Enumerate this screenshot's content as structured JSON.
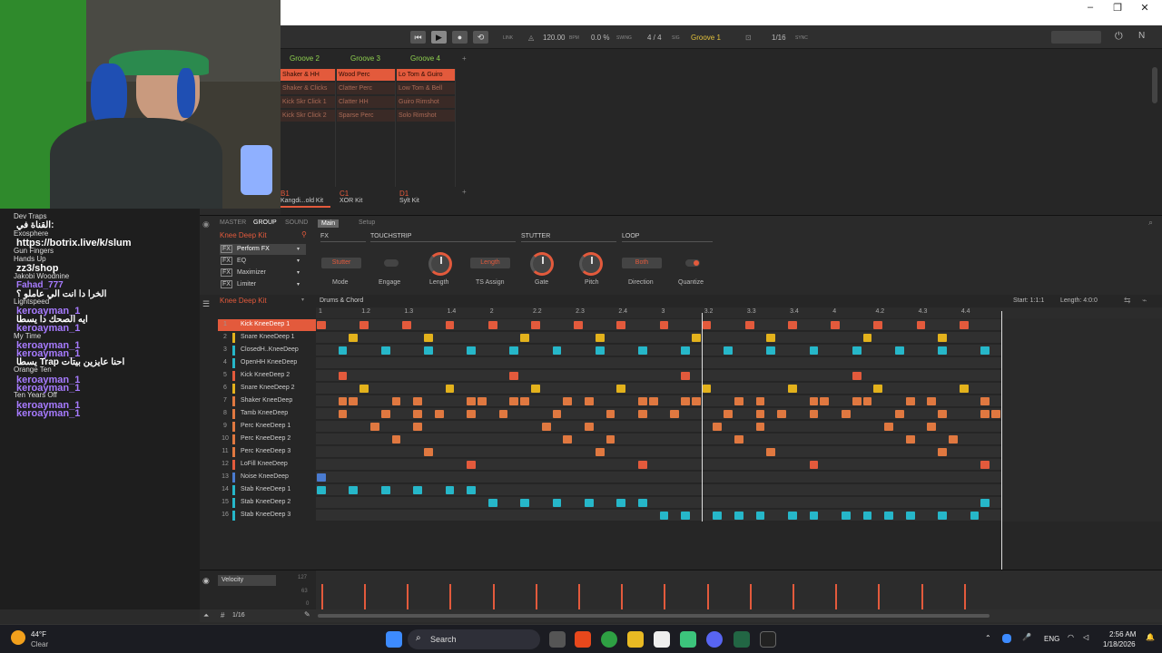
{
  "window": {
    "min": "–",
    "max": "❐",
    "close": "✕"
  },
  "transport": {
    "tempo": "120.00",
    "tempo_unit": "BPM",
    "swing": "0.0 %",
    "swing_label": "SWING",
    "sig": "4 / 4",
    "sig_label": "SIG",
    "groove": "Groove 1",
    "quant": "1/16",
    "sync": "SYNC",
    "link": "LINK"
  },
  "scenes": {
    "tabs": [
      "Groove 2",
      "Groove 3",
      "Groove 4"
    ],
    "add": "+",
    "col1": [
      "Shaker & HH",
      "Shaker & Clicks",
      "Kick Skr Click 1",
      "Kick Skr Click 2"
    ],
    "col2": [
      "Wood Perc",
      "Clatter Perc",
      "Clatter HH",
      "Sparse Perc"
    ],
    "col3": [
      "Lo Tom & Guiro",
      "Low Tom & Bell",
      "Guiro Rimshot",
      "Solo Rimshot"
    ],
    "banks": [
      {
        "id": "B1",
        "name": "Kangdi...old Kit"
      },
      {
        "id": "C1",
        "name": "XOR Kit"
      },
      {
        "id": "D1",
        "name": "Sylt Kit"
      }
    ],
    "bank_add": "+"
  },
  "chat": {
    "lines": [
      {
        "t": "Dev Traps",
        "c": "#ddd",
        "s": 8
      },
      {
        "t": "القناة في:",
        "c": "#fff",
        "s": 10
      },
      {
        "t": "Exosphere",
        "c": "#ddd",
        "s": 8
      },
      {
        "t": "https://botrix.live/k/slum",
        "c": "#fff",
        "s": 11
      },
      {
        "t": "Gun Fingers",
        "c": "#ddd",
        "s": 8
      },
      {
        "t": "Hands Up",
        "c": "#ddd",
        "s": 8
      },
      {
        "t": "zz3/shop",
        "c": "#fff",
        "s": 11
      },
      {
        "t": "Jakobi Woodnine",
        "c": "#ddd",
        "s": 8
      },
      {
        "t": "Fahad_777",
        "c": "#a77bff",
        "s": 10
      },
      {
        "t": "الخرا دا انت الي عاملو ؟",
        "c": "#fff",
        "s": 10
      },
      {
        "t": "Lightspeed",
        "c": "#ddd",
        "s": 8
      },
      {
        "t": "keroayman_1",
        "c": "#a77bff",
        "s": 11
      },
      {
        "t": "ايه الصحك دا يسطا",
        "c": "#fff",
        "s": 10
      },
      {
        "t": "keroayman_1",
        "c": "#a77bff",
        "s": 11
      },
      {
        "t": "My Time",
        "c": "#ddd",
        "s": 8
      },
      {
        "t": "keroayman_1",
        "c": "#a77bff",
        "s": 11
      },
      {
        "t": "keroayman_1",
        "c": "#a77bff",
        "s": 11
      },
      {
        "t": "يسطا Trap احنا عايزين بيتات",
        "c": "#fff",
        "s": 10
      },
      {
        "t": "Orange Ten",
        "c": "#ddd",
        "s": 8
      },
      {
        "t": "keroayman_1",
        "c": "#a77bff",
        "s": 11
      },
      {
        "t": "keroayman_1",
        "c": "#a77bff",
        "s": 11
      },
      {
        "t": "Ten Years Off",
        "c": "#ddd",
        "s": 8
      },
      {
        "t": "keroayman_1",
        "c": "#a77bff",
        "s": 11
      },
      {
        "t": "keroayman_1",
        "c": "#a77bff",
        "s": 11
      }
    ]
  },
  "fx": {
    "tabs": [
      "MASTER",
      "GROUP",
      "SOUND"
    ],
    "subtabs": [
      "Main",
      "Setup"
    ],
    "kit": "Knee Deep Kit",
    "slots": [
      "Perform FX",
      "EQ",
      "Maximizer",
      "Limiter"
    ],
    "sections": [
      "FX",
      "TOUCHSTRIP",
      "STUTTER",
      "LOOP"
    ],
    "params": {
      "mode_val": "Stutter",
      "mode": "Mode",
      "engage": "Engage",
      "length": "Length",
      "ts_val": "Length",
      "ts": "TS Assign",
      "gate": "Gate",
      "pitch": "Pitch",
      "dir_val": "Both",
      "dir": "Direction",
      "quantize": "Quantize"
    }
  },
  "pattern": {
    "kit": "Knee Deep Kit",
    "name": "Drums & Chord",
    "start": "Start: 1:1:1",
    "length": "Length: 4:0:0",
    "ruler": [
      "1",
      "1.2",
      "1.3",
      "1.4",
      "2",
      "2.2",
      "2.3",
      "2.4",
      "3",
      "3.2",
      "3.3",
      "3.4",
      "4",
      "4.2",
      "4.3",
      "4.4"
    ],
    "sounds": [
      {
        "n": "1",
        "name": "Kick KneeDeep 1",
        "color": "#e35a3c"
      },
      {
        "n": "2",
        "name": "Snare KneeDeep 1",
        "color": "#e3b21c"
      },
      {
        "n": "3",
        "name": "ClosedH..KneeDeep",
        "color": "#26b7c9"
      },
      {
        "n": "4",
        "name": "OpenHH KneeDeep",
        "color": "#26b7c9"
      },
      {
        "n": "5",
        "name": "Kick KneeDeep 2",
        "color": "#e35a3c"
      },
      {
        "n": "6",
        "name": "Snare KneeDeep 2",
        "color": "#e3b21c"
      },
      {
        "n": "7",
        "name": "Shaker KneeDeep",
        "color": "#e07840"
      },
      {
        "n": "8",
        "name": "Tamb KneeDeep",
        "color": "#e07840"
      },
      {
        "n": "9",
        "name": "Perc KneeDeep 1",
        "color": "#e07840"
      },
      {
        "n": "10",
        "name": "Perc KneeDeep 2",
        "color": "#e07840"
      },
      {
        "n": "11",
        "name": "Perc KneeDeep 3",
        "color": "#e07840"
      },
      {
        "n": "12",
        "name": "LoFill KneeDeep",
        "color": "#e35a3c"
      },
      {
        "n": "13",
        "name": "Noise KneeDeep",
        "color": "#4a7bd0"
      },
      {
        "n": "14",
        "name": "Stab KneeDeep 1",
        "color": "#26b7c9"
      },
      {
        "n": "15",
        "name": "Stab KneeDeep 2",
        "color": "#26b7c9"
      },
      {
        "n": "16",
        "name": "Stab KneeDeep 3",
        "color": "#26b7c9"
      }
    ],
    "steps": [
      [
        0,
        4,
        8,
        12,
        16,
        20,
        24,
        28,
        32,
        36,
        40,
        44,
        48,
        52,
        56,
        60
      ],
      [
        3,
        10,
        19,
        26,
        35,
        42,
        51,
        58
      ],
      [
        2,
        6,
        10,
        14,
        18,
        22,
        26,
        30,
        34,
        38,
        42,
        46,
        50,
        54,
        58,
        62
      ],
      [],
      [
        2,
        18,
        34,
        50
      ],
      [
        4,
        12,
        20,
        28,
        36,
        44,
        52,
        60
      ],
      [
        2,
        3,
        7,
        9,
        14,
        15,
        18,
        19,
        23,
        25,
        30,
        31,
        34,
        35,
        39,
        41,
        46,
        47,
        50,
        51,
        55,
        57,
        62
      ],
      [
        2,
        6,
        9,
        11,
        14,
        17,
        22,
        27,
        30,
        33,
        38,
        41,
        43,
        46,
        49,
        54,
        58,
        62,
        63
      ],
      [
        5,
        9,
        21,
        25,
        37,
        41,
        53,
        57
      ],
      [
        7,
        23,
        27,
        39,
        55,
        59
      ],
      [
        10,
        26,
        42,
        58
      ],
      [
        14,
        30,
        46,
        62
      ],
      [
        0
      ],
      [
        0,
        3,
        6,
        9,
        12,
        14
      ],
      [
        16,
        19,
        22,
        25,
        28,
        30,
        62
      ],
      [
        32,
        34,
        37,
        39,
        41,
        44,
        46,
        49,
        51,
        53,
        55,
        58,
        61
      ]
    ],
    "velocity": "Velocity",
    "vel_vals": [
      "127",
      "63",
      "0"
    ],
    "quant": "1/16"
  },
  "taskbar": {
    "weather_temp": "44°F",
    "weather": "Clear",
    "search": "Search",
    "lang": "ENG",
    "time": "2:56 AM",
    "date": "1/18/2026"
  }
}
